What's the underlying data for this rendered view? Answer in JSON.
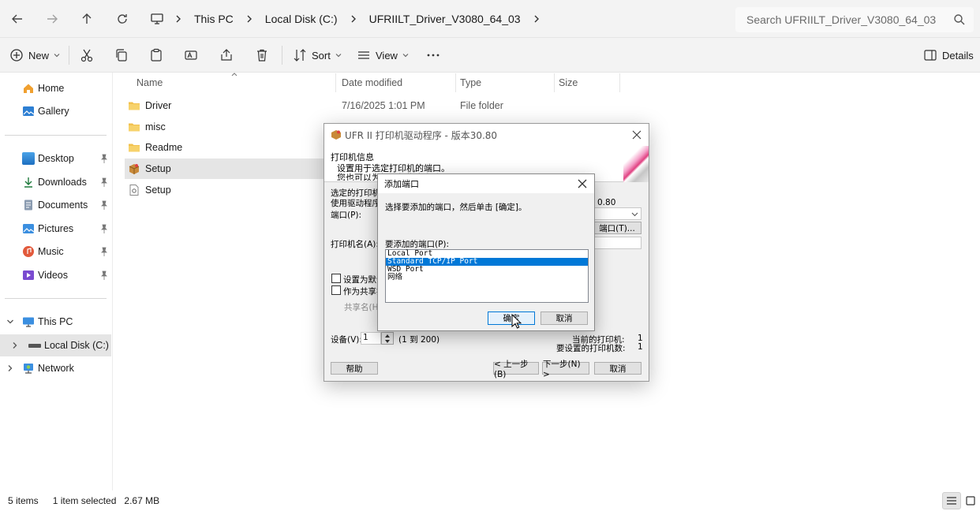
{
  "address_bar": {
    "crumbs": [
      "This PC",
      "Local Disk (C:)",
      "UFRIILT_Driver_V3080_64_03"
    ],
    "search_placeholder": "Search UFRIILT_Driver_V3080_64_03"
  },
  "toolbar": {
    "new_label": "New",
    "sort_label": "Sort",
    "view_label": "View",
    "details_label": "Details"
  },
  "sidebar": {
    "quick": [
      {
        "label": "Home"
      },
      {
        "label": "Gallery"
      }
    ],
    "pinned": [
      {
        "label": "Desktop"
      },
      {
        "label": "Downloads"
      },
      {
        "label": "Documents"
      },
      {
        "label": "Pictures"
      },
      {
        "label": "Music"
      },
      {
        "label": "Videos"
      }
    ],
    "tree": [
      {
        "label": "This PC"
      },
      {
        "label": "Local Disk (C:)"
      },
      {
        "label": "Network"
      }
    ]
  },
  "file_list": {
    "columns": [
      "Name",
      "Date modified",
      "Type",
      "Size"
    ],
    "rows": [
      {
        "name": "Driver",
        "date": "7/16/2025 1:01 PM",
        "type": "File folder"
      },
      {
        "name": "misc"
      },
      {
        "name": "Readme"
      },
      {
        "name": "Setup"
      },
      {
        "name": "Setup"
      }
    ]
  },
  "status_bar": {
    "items_count": "5 items",
    "selection": "1 item selected",
    "size": "2.67 MB"
  },
  "wizard": {
    "title": "UFR II 打印机驱动程序 - 版本30.80",
    "header_title": "打印机信息",
    "header_line1": "设置用于选定打印机的端口。",
    "header_line2": "您也可以为打印机指定名称",
    "selected_printer_label": "选定的打印机",
    "use_driver_label": "使用驱动程序",
    "port_label": "端口(P):",
    "version_fragment": "0.80",
    "add_port_button": "端口(T)...",
    "printer_name_label": "打印机名(A):",
    "set_default_label": "设置为默认",
    "share_label": "作为共享打",
    "share_name_label": "共享名(H)",
    "device_label": "设备(V):",
    "device_value": "1",
    "device_range": "(1 到 200)",
    "current_printers_label": "当前的打印机:",
    "current_printers_value": "1",
    "to_setup_label": "要设置的打印机数:",
    "to_setup_value": "1",
    "help_button": "帮助",
    "back_button": "< 上一步(B)",
    "next_button": "下一步(N) >",
    "cancel_button": "取消"
  },
  "add_port_dialog": {
    "title": "添加端口",
    "instruction": "选择要添加的端口，然后单击 [确定]。",
    "list_label": "要添加的端口(P):",
    "options": [
      "Local Port",
      "Standard TCP/IP Port",
      "WSD Port",
      "网络"
    ],
    "selected_option": "Standard TCP/IP Port",
    "ok_button": "确定",
    "cancel_button": "取消"
  }
}
